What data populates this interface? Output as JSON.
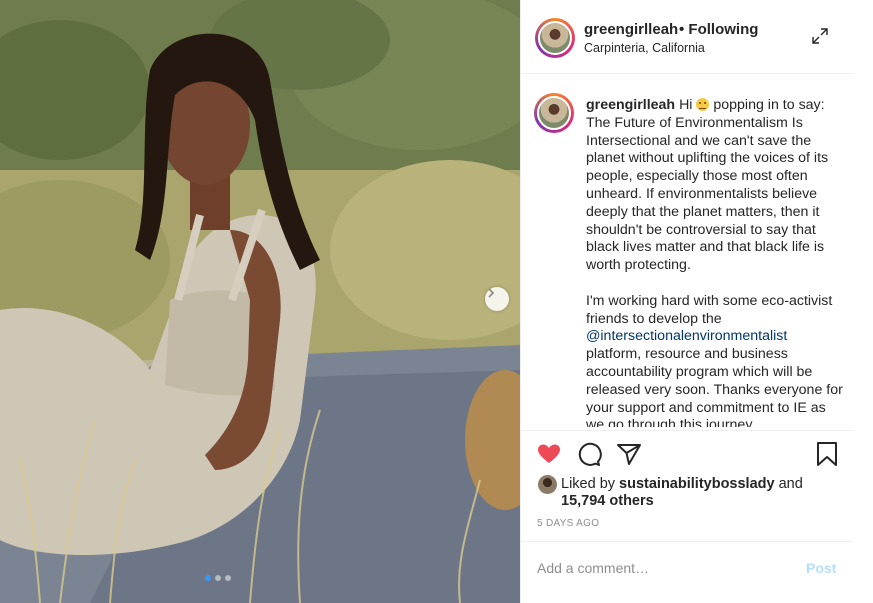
{
  "post": {
    "username": "greengirlleah",
    "follow_status": "• Following",
    "location": "Carpinteria, California",
    "caption": {
      "username": "greengirlleah",
      "intro": "Hi",
      "line1_rest": "popping in to say: The Future of Environmentalism Is Intersectional and we can't save the planet without uplifting the voices of its people, especially those most often unheard. If environmentalists believe deeply that the planet matters, then it shouldn't be controversial to say that black lives matter and that black life is worth protecting.",
      "para2_start": "I'm working hard with some eco-activist friends to develop the",
      "mention": "@intersectionalenvironmentalist",
      "para2_end": "platform, resource and business accountability program which will be released very soon. Thanks everyone for your support and commitment to IE as we go through this journey."
    },
    "likes": {
      "prefix": "Liked by",
      "user": "sustainabilitybosslady",
      "conj": "and",
      "count": "15,794 others"
    },
    "timestamp": "5 DAYS AGO",
    "comment_placeholder": "Add a comment…",
    "post_label": "Post",
    "liked": true,
    "carousel": {
      "total": 3,
      "current": 1
    }
  },
  "colors": {
    "heart": "#ed4956",
    "link": "#00376b",
    "post_disabled": "#b2dffc",
    "carousel_active": "#3897f0"
  },
  "icons": [
    "expand-icon",
    "heart-icon",
    "comment-icon",
    "share-icon",
    "bookmark-icon",
    "chevron-right-icon"
  ]
}
